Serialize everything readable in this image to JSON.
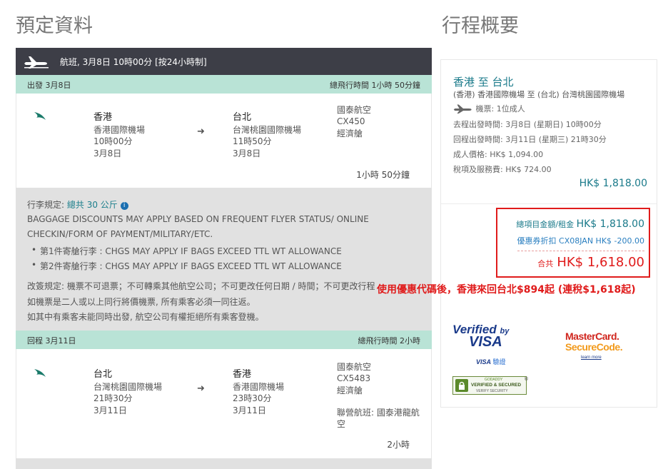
{
  "titles": {
    "left": "預定資料",
    "right": "行程概要"
  },
  "flight_bar": {
    "label": "航班, 3月8日 10時00分 [按24小時制]"
  },
  "outbound": {
    "header_left": "出發 3月8日",
    "header_right": "總飛行時間 1小時 50分鐘",
    "from": {
      "city": "香港",
      "airport": "香港國際機場",
      "time": "10時00分",
      "date": "3月8日"
    },
    "to": {
      "city": "台北",
      "airport": "台灣桃園國際機場",
      "time": "11時50分",
      "date": "3月8日"
    },
    "airline": "國泰航空",
    "flight_no": "CX450",
    "cabin": "經濟艙",
    "duration": "1小時 50分鐘"
  },
  "baggage": {
    "label": "行李規定:",
    "total": "總共 30 公斤",
    "info_icon": "info-icon",
    "line1": "BAGGAGE DISCOUNTS MAY APPLY BASED ON FREQUENT FLYER STATUS/ ONLINE",
    "line2": "CHECKIN/FORM OF PAYMENT/MILITARY/ETC.",
    "bag1_label": "第1件寄艙行李 :",
    "bag1_text": "CHGS MAY APPLY IF BAGS EXCEED TTL WT ALLOWANCE",
    "bag2_label": "第2件寄艙行李 :",
    "bag2_text": "CHGS MAY APPLY IF BAGS EXCEED TTL WT ALLOWANCE"
  },
  "rules": {
    "line1": "改簽規定: 機票不可退票；不可轉乘其他航空公司；不可更改任何日期 / 時間；不可更改行程",
    "line2": "如機票是二人或以上同行將價機票, 所有乘客必須一同往返。",
    "line3": "如其中有乘客未能同時出發, 航空公司有權拒絕所有乘客登機。"
  },
  "inbound": {
    "header_left": "回程 3月11日",
    "header_right": "總飛行時間 2小時",
    "from": {
      "city": "台北",
      "airport": "台灣桃園國際機場",
      "time": "21時30分",
      "date": "3月11日"
    },
    "to": {
      "city": "香港",
      "airport": "香港國際機場",
      "time": "23時30分",
      "date": "3月11日"
    },
    "airline": "國泰航空",
    "flight_no": "CX5483",
    "cabin": "經濟艙",
    "codeshare_1": "聯營航班: 國泰港龍航",
    "codeshare_2": "空",
    "duration": "2小時"
  },
  "summary": {
    "route": "香港  至  台北",
    "airports": "(香港) 香港國際機場  至  (台北) 台灣桃園國際機場",
    "ticket": "機票: 1位成人",
    "depart": "去程出發時間: 3月8日 (星期日) 10時00分",
    "return": "回程出發時間: 3月11日 (星期三) 21時30分",
    "adult_price": "成人價格: HK$ 1,094.00",
    "taxes": "稅項及服務費: HK$ 724.00",
    "subtotal": "HK$ 1,818.00"
  },
  "totals": {
    "item_label": "總項目金額/租金",
    "item_value": "HK$ 1,818.00",
    "coupon": "優惠券折扣 CX08JAN HK$ -200.00",
    "grand_label": "合共",
    "grand_value": "HK$ 1,618.00"
  },
  "promo_note": "使用優惠代碼後，香港來回台北$894起 (連稅$1,618起)",
  "badges": {
    "vbv_1": "Verified",
    "vbv_by": "by",
    "vbv_2": "VISA",
    "vbv_3": "VISA",
    "vbv_4": "驗證",
    "mc_1": "MasterCard.",
    "mc_2": "SecureCode.",
    "mc_3": "learn more",
    "gd_1": "GODADDY",
    "gd_2": "VERIFIED & SECURED",
    "gd_3": "VERIFY SECURITY"
  },
  "colors": {
    "teal": "#1a7a8a",
    "header_mint": "#b9e3d6",
    "dark_bar": "#3d3e47",
    "alert_red": "#e01b1b"
  }
}
